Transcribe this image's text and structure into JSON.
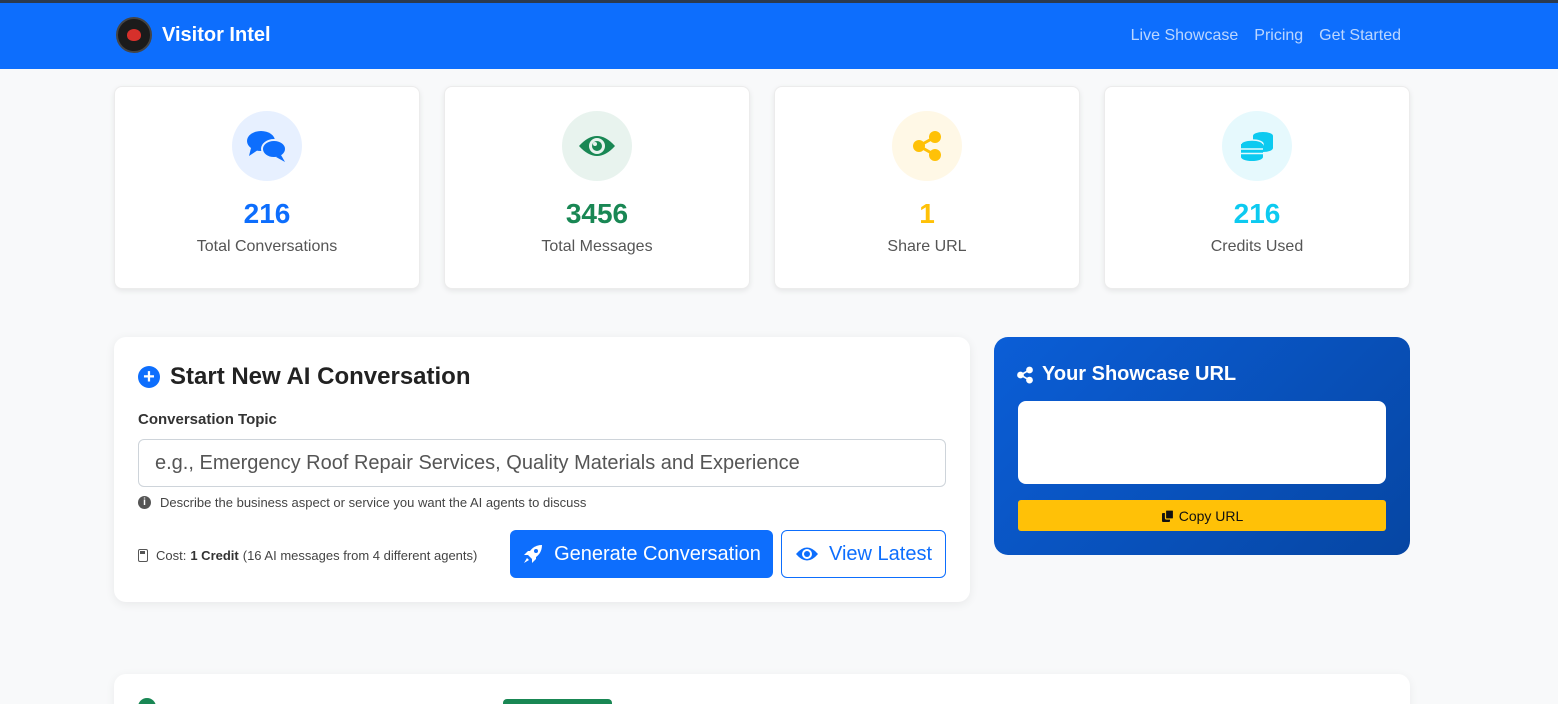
{
  "navbar": {
    "brand": "Visitor Intel",
    "links": [
      "Live Showcase",
      "Pricing",
      "Get Started"
    ],
    "color": "#0d6efd"
  },
  "stats": [
    {
      "value": "216",
      "label": "Total Conversations",
      "icon": "comments-icon",
      "color": "#0d6efd",
      "bg": "#e7f0ff"
    },
    {
      "value": "3456",
      "label": "Total Messages",
      "icon": "eye-icon",
      "color": "#198754",
      "bg": "#e8f3ee"
    },
    {
      "value": "1",
      "label": "Share URL",
      "icon": "share-icon",
      "color": "#ffc107",
      "bg": "#fff8e6"
    },
    {
      "value": "216",
      "label": "Credits Used",
      "icon": "coins-icon",
      "color": "#0dcaf0",
      "bg": "#e6f9fd"
    }
  ],
  "conversation": {
    "title": "Start New AI Conversation",
    "field_label": "Conversation Topic",
    "placeholder": "e.g., Emergency Roof Repair Services, Quality Materials and Experience",
    "help": "Describe the business aspect or service you want the AI agents to discuss",
    "cost_prefix": "Cost:",
    "cost_value": "1 Credit",
    "cost_detail": "(16 AI messages from 4 different agents)",
    "generate_label": "Generate Conversation",
    "view_label": "View Latest"
  },
  "showcase": {
    "title": "Your Showcase URL",
    "url": "",
    "copy_label": "Copy URL"
  }
}
